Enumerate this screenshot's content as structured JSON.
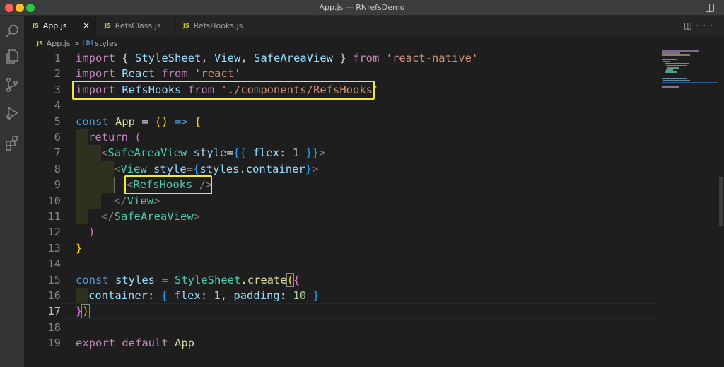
{
  "window": {
    "title": "App.js — RNrefsDemo"
  },
  "tabs": [
    {
      "label": "App.js",
      "badge": "JS",
      "active": true,
      "close": "×"
    },
    {
      "label": "RefsClass.js",
      "badge": "JS",
      "active": false
    },
    {
      "label": "RefsHooks.js",
      "badge": "JS",
      "active": false
    }
  ],
  "breadcrumb": {
    "badge": "JS",
    "file": "App.js",
    "separator": ">",
    "symbol_icon": "[⊕]",
    "symbol": "styles"
  },
  "icons": {
    "activity": [
      "search-icon",
      "explorer-icon",
      "source-control-icon",
      "run-debug-icon",
      "extensions-icon"
    ],
    "editor": [
      "split-editor-icon",
      "more-actions-icon"
    ]
  },
  "editor": {
    "line_numbers": [
      "1",
      "2",
      "3",
      "4",
      "5",
      "6",
      "7",
      "8",
      "9",
      "10",
      "11",
      "12",
      "13",
      "14",
      "15",
      "16",
      "17",
      "18",
      "19"
    ],
    "active_line": "17",
    "lines": {
      "l1": {
        "a": "import",
        "b": " { ",
        "c": "StyleSheet",
        "d": ", ",
        "e": "View",
        "f": ", ",
        "g": "SafeAreaView",
        "h": " } ",
        "i": "from",
        "j": " ",
        "k": "'react-native'"
      },
      "l2": {
        "a": "import",
        "b": " ",
        "c": "React",
        "d": " ",
        "e": "from",
        "f": " ",
        "g": "'react'"
      },
      "l3": {
        "a": "import",
        "b": " ",
        "c": "RefsHooks",
        "d": " ",
        "e": "from",
        "f": " ",
        "g": "'./components/RefsHooks'"
      },
      "l5": {
        "a": "const",
        "b": " ",
        "c": "App",
        "d": " = ",
        "e": "()",
        "f": " ",
        "g": "=>",
        "h": " ",
        "i": "{"
      },
      "l6": {
        "a": "return",
        "b": " ",
        "c": "("
      },
      "l7": {
        "a": "<",
        "b": "SafeAreaView",
        "c": " ",
        "d": "style",
        "e": "=",
        "f": "{{",
        "g": " ",
        "h": "flex",
        "i": ": ",
        "j": "1",
        "k": " ",
        "l": "}}",
        "m": ">"
      },
      "l8": {
        "a": "<",
        "b": "View",
        "c": " ",
        "d": "style",
        "e": "=",
        "f": "{",
        "g": "styles",
        "h": ".",
        "i": "container",
        "j": "}",
        "k": ">"
      },
      "l9": {
        "a": "<",
        "b": "RefsHooks",
        "c": " ",
        "d": "/>"
      },
      "l10": {
        "a": "</",
        "b": "View",
        "c": ">"
      },
      "l11": {
        "a": "</",
        "b": "SafeAreaView",
        "c": ">"
      },
      "l12": {
        "a": ")"
      },
      "l13": {
        "a": "}"
      },
      "l15": {
        "a": "const",
        "b": " ",
        "c": "styles",
        "d": " = ",
        "e": "StyleSheet",
        "f": ".",
        "g": "create",
        "h": "(",
        "i": "{"
      },
      "l16": {
        "a": "container",
        "b": ": ",
        "c": "{",
        "d": " ",
        "e": "flex",
        "f": ": ",
        "g": "1",
        "h": ", ",
        "i": "padding",
        "j": ": ",
        "k": "10",
        "l": " ",
        "m": "}"
      },
      "l17": {
        "a": "}",
        "b": ")"
      },
      "l19": {
        "a": "export",
        "b": " ",
        "c": "default",
        "d": " ",
        "e": "App"
      }
    }
  },
  "colors": {
    "highlight_box": "#f0e442",
    "keyword": "#c586c0",
    "string": "#ce9178",
    "type": "#4ec9b0",
    "variable": "#9cdcfe"
  }
}
